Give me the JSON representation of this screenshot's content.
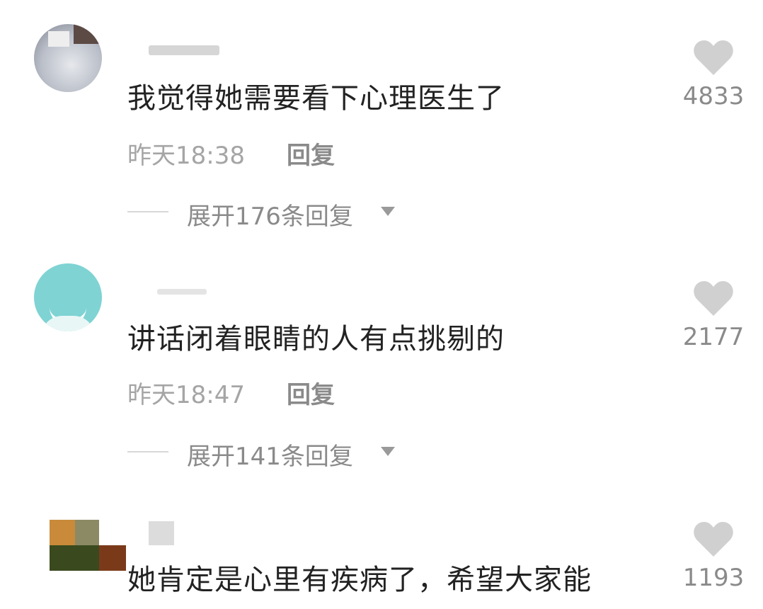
{
  "comments": [
    {
      "text": "我觉得她需要看下心理医生了",
      "time": "昨天18:38",
      "reply_label": "回复",
      "expand_label": "展开176条回复",
      "likes": "4833",
      "avatar": "avatar-photo"
    },
    {
      "text": "讲话闭着眼睛的人有点挑剔的",
      "time": "昨天18:47",
      "reply_label": "回复",
      "expand_label": "展开141条回复",
      "likes": "2177",
      "avatar": "avatar-teal"
    },
    {
      "text": "她肯定是心里有疾病了，希望大家能",
      "likes": "1193",
      "avatar": "avatar-pixel"
    }
  ],
  "icons": {
    "like": "heart-icon",
    "expand": "caret-down-icon"
  },
  "colors": {
    "text": "#222222",
    "meta": "#a5a5a5",
    "heart": "#d0d0d0"
  }
}
